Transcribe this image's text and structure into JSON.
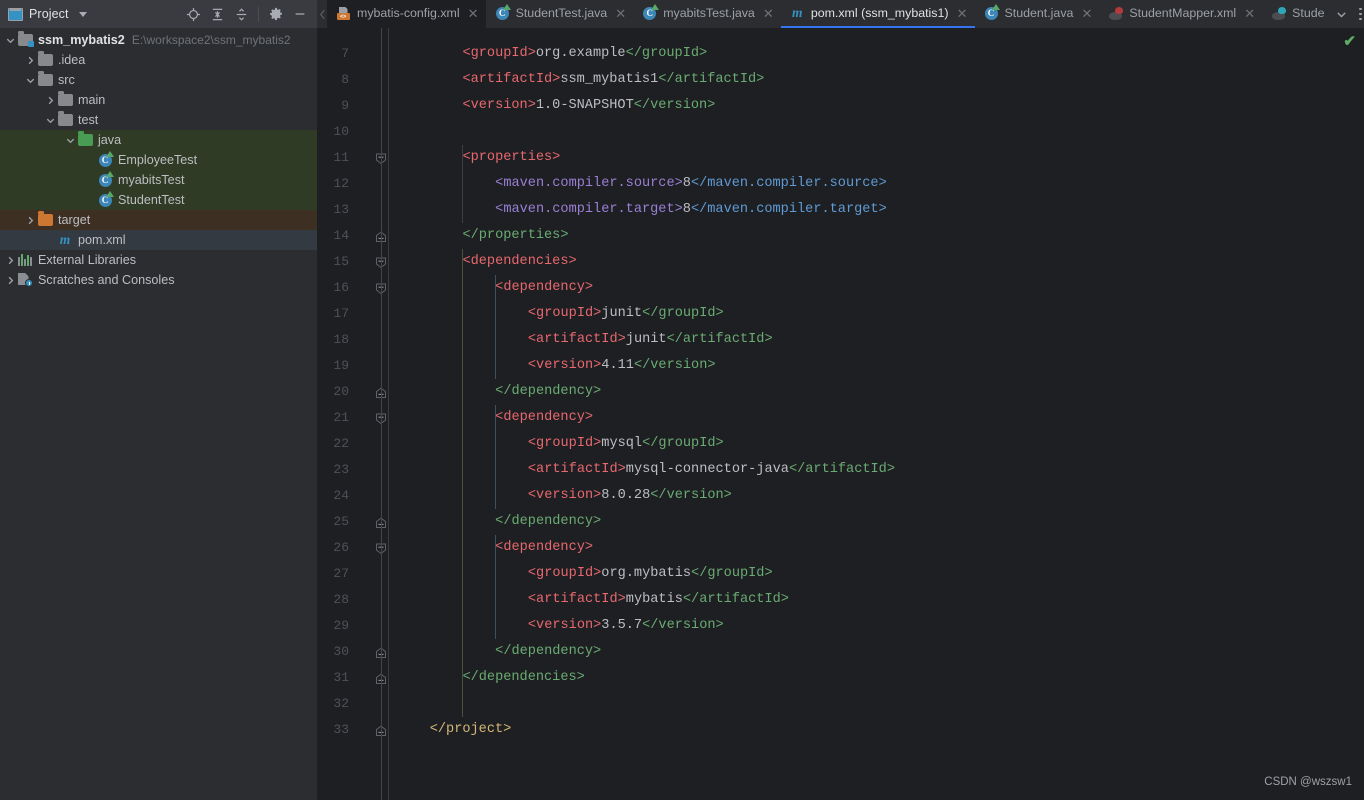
{
  "panel": {
    "title": "Project",
    "icons": {
      "project_icon": "project-window-icon",
      "locate": "locate-crosshair-icon",
      "expand_all": "expand-all-icon",
      "collapse_all": "collapse-all-icon",
      "settings": "gear-icon",
      "hide": "minimize-icon",
      "dropdown": "chevron-down-icon"
    }
  },
  "tree": [
    {
      "label": "ssm_mybatis2",
      "sub": "E:\\workspace2\\ssm_mybatis2",
      "indent": 1,
      "arrow": "down",
      "icon": "module-folder-icon",
      "bold": true,
      "state": "none"
    },
    {
      "label": ".idea",
      "sub": "",
      "indent": 2,
      "arrow": "right",
      "icon": "folder-icon",
      "bold": false,
      "state": "none"
    },
    {
      "label": "src",
      "sub": "",
      "indent": 2,
      "arrow": "down",
      "icon": "folder-icon",
      "bold": false,
      "state": "none"
    },
    {
      "label": "main",
      "sub": "",
      "indent": 3,
      "arrow": "right",
      "icon": "folder-icon",
      "bold": false,
      "state": "none"
    },
    {
      "label": "test",
      "sub": "",
      "indent": 3,
      "arrow": "down",
      "icon": "folder-icon",
      "bold": false,
      "state": "none"
    },
    {
      "label": "java",
      "sub": "",
      "indent": 4,
      "arrow": "down",
      "icon": "test-source-folder-icon",
      "bold": false,
      "state": "test"
    },
    {
      "label": "EmployeeTest",
      "sub": "",
      "indent": 5,
      "arrow": "none",
      "icon": "java-class-icon",
      "bold": false,
      "state": "test"
    },
    {
      "label": "myabitsTest",
      "sub": "",
      "indent": 5,
      "arrow": "none",
      "icon": "java-class-icon",
      "bold": false,
      "state": "test"
    },
    {
      "label": "StudentTest",
      "sub": "",
      "indent": 5,
      "arrow": "none",
      "icon": "java-class-icon",
      "bold": false,
      "state": "test"
    },
    {
      "label": "target",
      "sub": "",
      "indent": 2,
      "arrow": "right",
      "icon": "excluded-folder-icon",
      "bold": false,
      "state": "target"
    },
    {
      "label": "pom.xml",
      "sub": "",
      "indent": 3,
      "arrow": "none",
      "icon": "maven-icon",
      "bold": false,
      "state": "selected"
    },
    {
      "label": "External Libraries",
      "sub": "",
      "indent": 1,
      "arrow": "right",
      "icon": "libraries-icon",
      "bold": false,
      "state": "none"
    },
    {
      "label": "Scratches and Consoles",
      "sub": "",
      "indent": 1,
      "arrow": "right",
      "icon": "scratches-icon",
      "bold": false,
      "state": "none"
    }
  ],
  "tabs": [
    {
      "label": "mybatis-config.xml",
      "icon": "xml-config-icon",
      "active": false,
      "closable": true
    },
    {
      "label": "StudentTest.java",
      "icon": "java-class-icon",
      "active": false,
      "closable": true
    },
    {
      "label": "myabitsTest.java",
      "icon": "java-class-icon",
      "active": false,
      "closable": true
    },
    {
      "label": "pom.xml (ssm_mybatis1)",
      "icon": "maven-icon",
      "active": true,
      "closable": true
    },
    {
      "label": "Student.java",
      "icon": "java-class-icon",
      "active": false,
      "closable": true
    },
    {
      "label": "StudentMapper.xml",
      "icon": "mybatis-mapper-icon",
      "active": false,
      "closable": true
    },
    {
      "label": "Stude",
      "icon": "mybatis-mapper-icon-teal",
      "active": false,
      "closable": false
    }
  ],
  "editor": {
    "file": "pom.xml",
    "inspection_status": "✔",
    "first_visible_line": 6,
    "lines": [
      {
        "n": 7,
        "indent": 2,
        "fold": "none",
        "segs": [
          [
            "t-tag",
            "<groupId>"
          ],
          [
            "t-txt",
            "org.example"
          ],
          [
            "t-tag2",
            "</groupId>"
          ]
        ]
      },
      {
        "n": 8,
        "indent": 2,
        "fold": "none",
        "segs": [
          [
            "t-tag",
            "<artifactId>"
          ],
          [
            "t-txt",
            "ssm_mybatis1"
          ],
          [
            "t-tag2",
            "</artifactId>"
          ]
        ]
      },
      {
        "n": 9,
        "indent": 2,
        "fold": "none",
        "segs": [
          [
            "t-tag",
            "<version>"
          ],
          [
            "t-txt",
            "1.0-SNAPSHOT"
          ],
          [
            "t-tag2",
            "</version>"
          ]
        ]
      },
      {
        "n": 10,
        "indent": 0,
        "fold": "none",
        "segs": []
      },
      {
        "n": 11,
        "indent": 2,
        "fold": "open",
        "segs": [
          [
            "t-tag",
            "<properties>"
          ]
        ]
      },
      {
        "n": 12,
        "indent": 3,
        "fold": "none",
        "segs": [
          [
            "t-prop",
            "<maven.compiler.source>"
          ],
          [
            "t-txt",
            "8"
          ],
          [
            "t-propb",
            "</maven.compiler.source>"
          ]
        ]
      },
      {
        "n": 13,
        "indent": 3,
        "fold": "none",
        "segs": [
          [
            "t-prop",
            "<maven.compiler.target>"
          ],
          [
            "t-txt",
            "8"
          ],
          [
            "t-propb",
            "</maven.compiler.target>"
          ]
        ]
      },
      {
        "n": 14,
        "indent": 2,
        "fold": "close",
        "segs": [
          [
            "t-tag2",
            "</properties>"
          ]
        ]
      },
      {
        "n": 15,
        "indent": 2,
        "fold": "open",
        "segs": [
          [
            "t-tag",
            "<dependencies>"
          ]
        ]
      },
      {
        "n": 16,
        "indent": 3,
        "fold": "open",
        "segs": [
          [
            "t-tag",
            "<dependency>"
          ]
        ]
      },
      {
        "n": 17,
        "indent": 4,
        "fold": "none",
        "segs": [
          [
            "t-tag",
            "<groupId>"
          ],
          [
            "t-txt",
            "junit"
          ],
          [
            "t-tag2",
            "</groupId>"
          ]
        ]
      },
      {
        "n": 18,
        "indent": 4,
        "fold": "none",
        "segs": [
          [
            "t-tag",
            "<artifactId>"
          ],
          [
            "t-txt",
            "junit"
          ],
          [
            "t-tag2",
            "</artifactId>"
          ]
        ]
      },
      {
        "n": 19,
        "indent": 4,
        "fold": "none",
        "segs": [
          [
            "t-tag",
            "<version>"
          ],
          [
            "t-txt",
            "4.11"
          ],
          [
            "t-tag2",
            "</version>"
          ]
        ]
      },
      {
        "n": 20,
        "indent": 3,
        "fold": "close",
        "segs": [
          [
            "t-tag2",
            "</dependency>"
          ]
        ]
      },
      {
        "n": 21,
        "indent": 3,
        "fold": "open",
        "segs": [
          [
            "t-tag",
            "<dependency>"
          ]
        ]
      },
      {
        "n": 22,
        "indent": 4,
        "fold": "none",
        "segs": [
          [
            "t-tag",
            "<groupId>"
          ],
          [
            "t-txt",
            "mysql"
          ],
          [
            "t-tag2",
            "</groupId>"
          ]
        ]
      },
      {
        "n": 23,
        "indent": 4,
        "fold": "none",
        "segs": [
          [
            "t-tag",
            "<artifactId>"
          ],
          [
            "t-txt",
            "mysql-connector-java"
          ],
          [
            "t-tag2",
            "</artifactId>"
          ]
        ]
      },
      {
        "n": 24,
        "indent": 4,
        "fold": "none",
        "segs": [
          [
            "t-tag",
            "<version>"
          ],
          [
            "t-txt",
            "8.0.28"
          ],
          [
            "t-tag2",
            "</version>"
          ]
        ]
      },
      {
        "n": 25,
        "indent": 3,
        "fold": "close",
        "segs": [
          [
            "t-tag2",
            "</dependency>"
          ]
        ]
      },
      {
        "n": 26,
        "indent": 3,
        "fold": "open",
        "segs": [
          [
            "t-tag",
            "<dependency>"
          ]
        ]
      },
      {
        "n": 27,
        "indent": 4,
        "fold": "none",
        "segs": [
          [
            "t-tag",
            "<groupId>"
          ],
          [
            "t-txt",
            "org.mybatis"
          ],
          [
            "t-tag2",
            "</groupId>"
          ]
        ]
      },
      {
        "n": 28,
        "indent": 4,
        "fold": "none",
        "segs": [
          [
            "t-tag",
            "<artifactId>"
          ],
          [
            "t-txt",
            "mybatis"
          ],
          [
            "t-tag2",
            "</artifactId>"
          ]
        ]
      },
      {
        "n": 29,
        "indent": 4,
        "fold": "none",
        "segs": [
          [
            "t-tag",
            "<version>"
          ],
          [
            "t-txt",
            "3.5.7"
          ],
          [
            "t-tag2",
            "</version>"
          ]
        ]
      },
      {
        "n": 30,
        "indent": 3,
        "fold": "close",
        "segs": [
          [
            "t-tag2",
            "</dependency>"
          ]
        ]
      },
      {
        "n": 31,
        "indent": 2,
        "fold": "close",
        "segs": [
          [
            "t-tag2",
            "</dependencies>"
          ]
        ]
      },
      {
        "n": 32,
        "indent": 0,
        "fold": "none",
        "segs": []
      },
      {
        "n": 33,
        "indent": 1,
        "fold": "close",
        "segs": [
          [
            "t-yellow",
            "</project>"
          ]
        ]
      }
    ]
  },
  "watermark": "CSDN @wszsw1",
  "colors": {
    "accent": "#3574f0",
    "test_source_bg": "#2f3b24",
    "excluded_bg": "#3d2f22",
    "editor_bg": "#1e1f22",
    "panel_bg": "#2b2d30",
    "tag": "#e8686f",
    "close_tag": "#6aab73",
    "value": "#bcbec4"
  }
}
